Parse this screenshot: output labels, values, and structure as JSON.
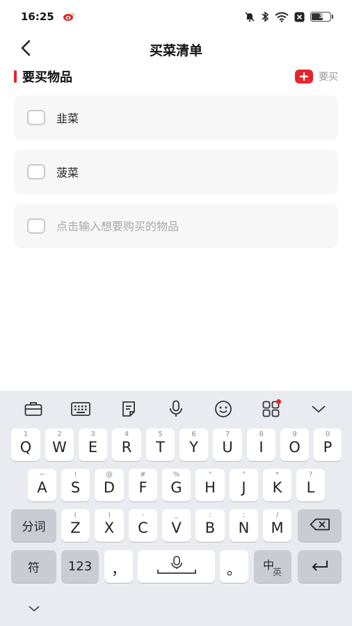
{
  "status_bar": {
    "time": "16:25",
    "battery_level": "34"
  },
  "nav": {
    "title": "买菜清单"
  },
  "section": {
    "title": "要买物品",
    "add_label": "要买"
  },
  "items": [
    {
      "text": "韭菜"
    },
    {
      "text": "菠菜"
    }
  ],
  "new_item": {
    "placeholder": "点击输入想要购买的物品",
    "value": ""
  },
  "keyboard": {
    "row1": [
      {
        "main": "Q",
        "sub": "1"
      },
      {
        "main": "W",
        "sub": "2"
      },
      {
        "main": "E",
        "sub": "3"
      },
      {
        "main": "R",
        "sub": "4"
      },
      {
        "main": "T",
        "sub": "5"
      },
      {
        "main": "Y",
        "sub": "6"
      },
      {
        "main": "U",
        "sub": "7"
      },
      {
        "main": "I",
        "sub": "8"
      },
      {
        "main": "O",
        "sub": "9"
      },
      {
        "main": "P",
        "sub": "0"
      }
    ],
    "row2": [
      {
        "main": "A",
        "sub": "~"
      },
      {
        "main": "S",
        "sub": "!"
      },
      {
        "main": "D",
        "sub": "@"
      },
      {
        "main": "F",
        "sub": "#"
      },
      {
        "main": "G",
        "sub": "%"
      },
      {
        "main": "H",
        "sub": "\""
      },
      {
        "main": "J",
        "sub": "\""
      },
      {
        "main": "K",
        "sub": "*"
      },
      {
        "main": "L",
        "sub": "?"
      }
    ],
    "row3": [
      {
        "main": "Z",
        "sub": "("
      },
      {
        "main": "X",
        "sub": ")"
      },
      {
        "main": "C",
        "sub": "-"
      },
      {
        "main": "V",
        "sub": "_"
      },
      {
        "main": "B",
        "sub": ":"
      },
      {
        "main": "N",
        "sub": ";"
      },
      {
        "main": "M",
        "sub": "/"
      }
    ],
    "segment_label": "分词",
    "symbol_label": "符",
    "numbers_label": "123",
    "comma_label": "，",
    "period_label": "。",
    "lang_zh": "中",
    "lang_en": "英"
  },
  "colors": {
    "accent": "#e8232b",
    "keyboard_bg": "#e9ebf0"
  }
}
